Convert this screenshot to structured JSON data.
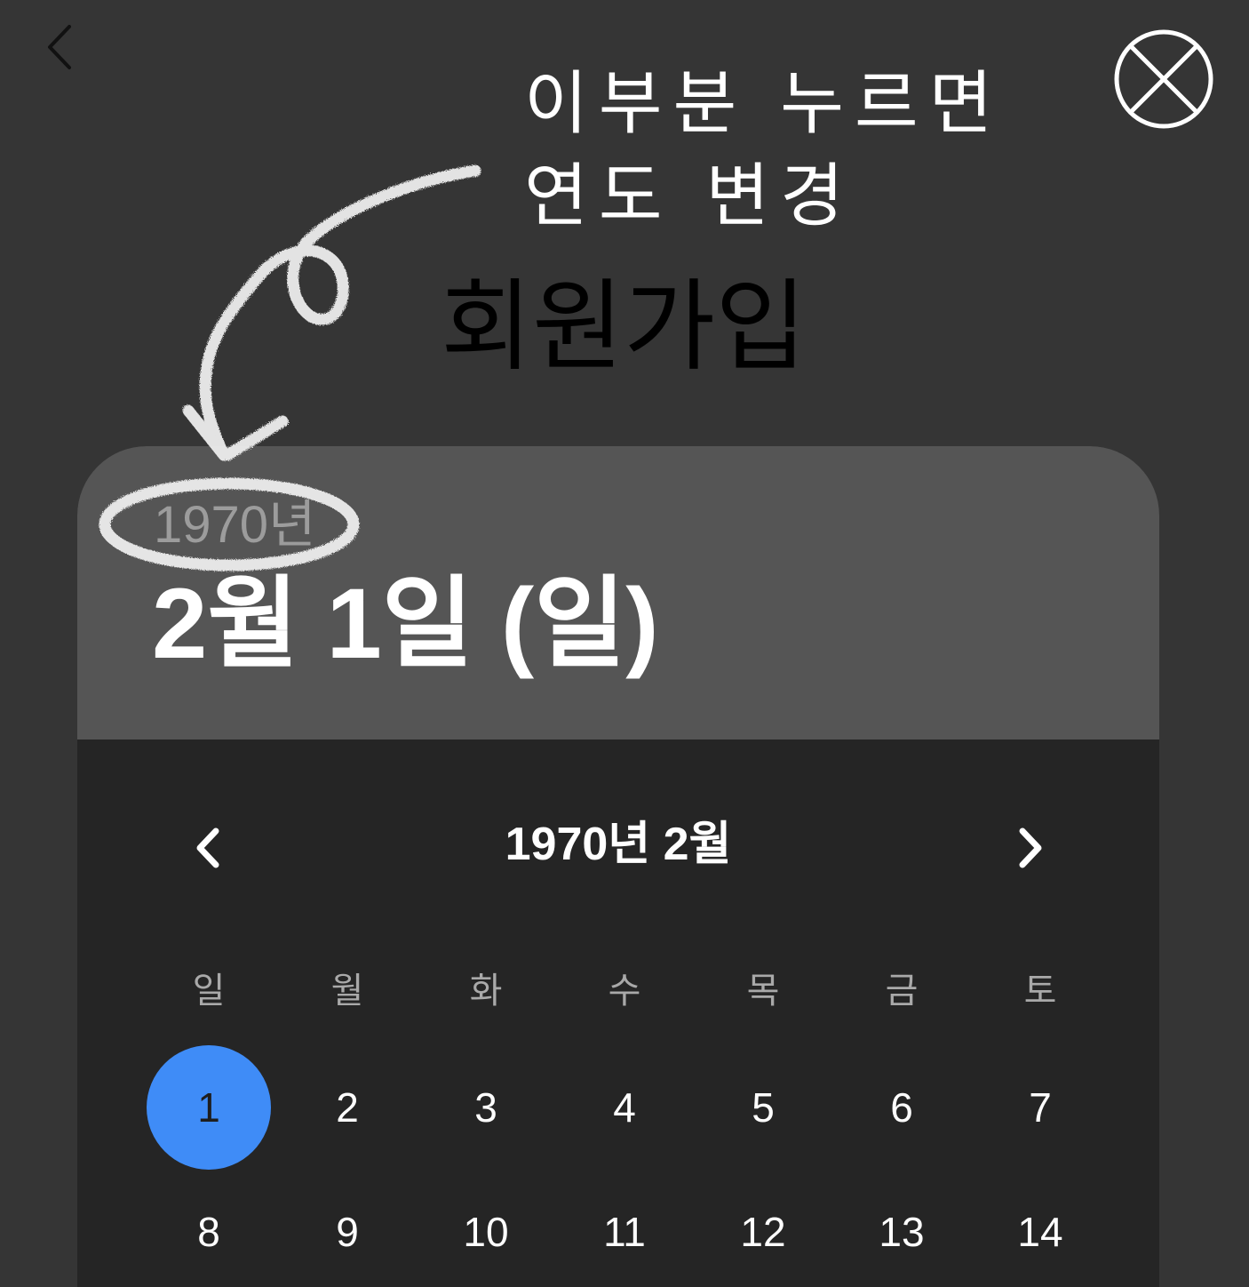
{
  "header": {
    "back_icon": "chevron-left-icon",
    "close_icon": "circle-x-icon",
    "title": "회원가입"
  },
  "annotation": {
    "line1": "이부분 누르면",
    "line2": "연도 변경"
  },
  "date_picker": {
    "year_label": "1970년",
    "selected_date": "2월 1일 (일)",
    "month_title": "1970년 2월",
    "prev_icon": "chevron-left-icon",
    "next_icon": "chevron-right-icon",
    "weekdays": [
      "일",
      "월",
      "화",
      "수",
      "목",
      "금",
      "토"
    ],
    "weeks": [
      [
        "1",
        "2",
        "3",
        "4",
        "5",
        "6",
        "7"
      ],
      [
        "8",
        "9",
        "10",
        "11",
        "12",
        "13",
        "14"
      ]
    ],
    "selected_day": "1",
    "colors": {
      "background": "#353535",
      "header_bg": "#555555",
      "body_bg": "#252525",
      "accent": "#3f8cf7"
    }
  }
}
